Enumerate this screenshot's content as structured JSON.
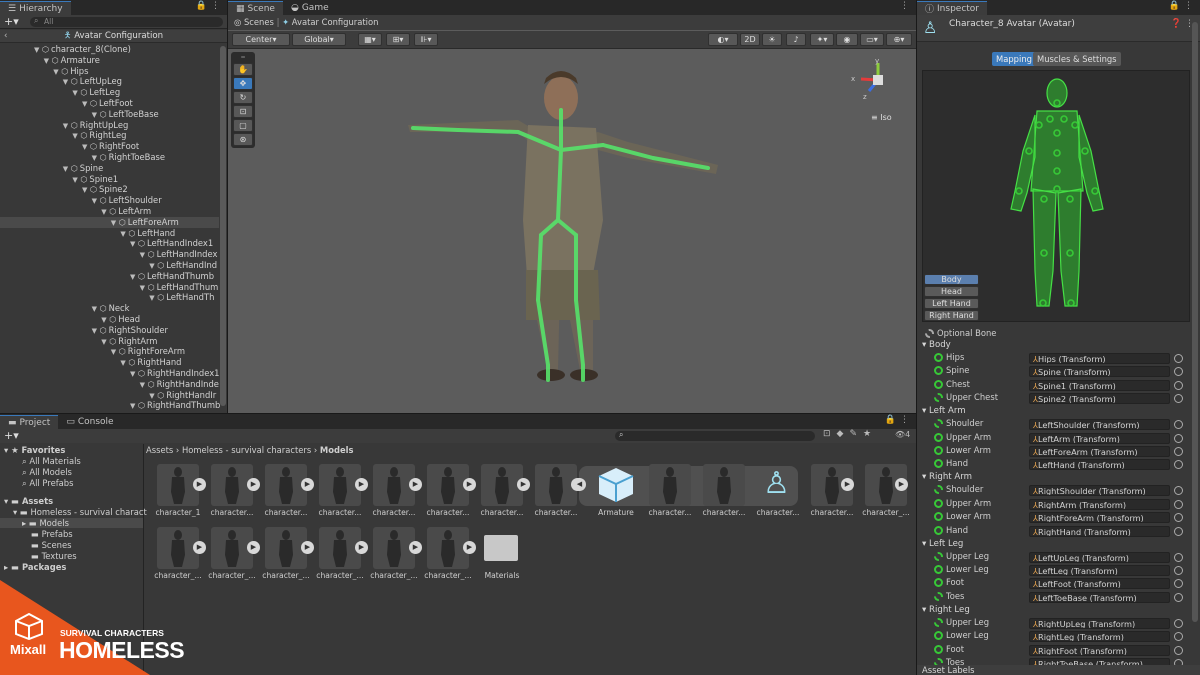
{
  "hierarchy": {
    "tab": "Hierarchy",
    "search_placeholder": "All",
    "header": "Avatar Configuration",
    "rows": [
      {
        "label": "character_8(Clone)",
        "indent": 0
      },
      {
        "label": "Armature",
        "indent": 1
      },
      {
        "label": "Hips",
        "indent": 2
      },
      {
        "label": "LeftUpLeg",
        "indent": 3
      },
      {
        "label": "LeftLeg",
        "indent": 4
      },
      {
        "label": "LeftFoot",
        "indent": 5
      },
      {
        "label": "LeftToeBase",
        "indent": 6
      },
      {
        "label": "RightUpLeg",
        "indent": 3
      },
      {
        "label": "RightLeg",
        "indent": 4
      },
      {
        "label": "RightFoot",
        "indent": 5
      },
      {
        "label": "RightToeBase",
        "indent": 6
      },
      {
        "label": "Spine",
        "indent": 3
      },
      {
        "label": "Spine1",
        "indent": 4
      },
      {
        "label": "Spine2",
        "indent": 5
      },
      {
        "label": "LeftShoulder",
        "indent": 6
      },
      {
        "label": "LeftArm",
        "indent": 7
      },
      {
        "label": "LeftForeArm",
        "indent": 8
      },
      {
        "label": "LeftHand",
        "indent": 9
      },
      {
        "label": "LeftHandIndex1",
        "indent": 10
      },
      {
        "label": "LeftHandIndex",
        "indent": 11
      },
      {
        "label": "LeftHandInd",
        "indent": 12
      },
      {
        "label": "LeftHandThumb",
        "indent": 10
      },
      {
        "label": "LeftHandThum",
        "indent": 11
      },
      {
        "label": "LeftHandTh",
        "indent": 12
      },
      {
        "label": "Neck",
        "indent": 6
      },
      {
        "label": "Head",
        "indent": 7
      },
      {
        "label": "RightShoulder",
        "indent": 6
      },
      {
        "label": "RightArm",
        "indent": 7
      },
      {
        "label": "RightForeArm",
        "indent": 8
      },
      {
        "label": "RightHand",
        "indent": 9
      },
      {
        "label": "RightHandIndex1",
        "indent": 10
      },
      {
        "label": "RightHandInde",
        "indent": 11
      },
      {
        "label": "RightHandIr",
        "indent": 12
      },
      {
        "label": "RightHandThumb",
        "indent": 10
      }
    ]
  },
  "scene": {
    "tabs": [
      "Scene",
      "Game"
    ],
    "breadcrumb_root": "Scenes",
    "breadcrumb_current": "Avatar Configuration",
    "pivot": "Center",
    "space": "Global",
    "mode_2d": "2D",
    "gizmo_label": "Iso",
    "axis_x": "x",
    "axis_y": "y",
    "axis_z": "z"
  },
  "project": {
    "tabs": [
      "Project",
      "Console"
    ],
    "favorites": "Favorites",
    "fav_items": [
      "All Materials",
      "All Models",
      "All Prefabs"
    ],
    "assets": "Assets",
    "asset_folder": "Homeless - survival charact",
    "subfolders": [
      "Models",
      "Prefabs",
      "Scenes",
      "Textures"
    ],
    "packages": "Packages",
    "breadcrumb": [
      "Assets",
      "Homeless - survival characters",
      "Models"
    ],
    "hidden_count": "4",
    "row1": [
      "character_1",
      "character...",
      "character...",
      "character...",
      "character...",
      "character...",
      "character...",
      "character...",
      "Armature",
      "character...",
      "character...",
      "character...",
      "character...",
      "character_..."
    ],
    "row2": [
      "character_...",
      "character_...",
      "character_...",
      "character_...",
      "character_...",
      "character_...",
      "Materials"
    ]
  },
  "inspector": {
    "tab": "Inspector",
    "title": "Character_8 Avatar (Avatar)",
    "tabs": [
      "Mapping",
      "Muscles & Settings"
    ],
    "body_buttons": [
      "Body",
      "Head",
      "Left Hand",
      "Right Hand"
    ],
    "optional_bone": "Optional Bone",
    "sections": [
      {
        "name": "Body",
        "bones": [
          [
            "Hips",
            "Hips (Transform)"
          ],
          [
            "Spine",
            "Spine (Transform)"
          ],
          [
            "Chest",
            "Spine1 (Transform)"
          ],
          [
            "Upper Chest",
            "Spine2 (Transform)"
          ]
        ]
      },
      {
        "name": "Left Arm",
        "bones": [
          [
            "Shoulder",
            "LeftShoulder (Transform)"
          ],
          [
            "Upper Arm",
            "LeftArm (Transform)"
          ],
          [
            "Lower Arm",
            "LeftForeArm (Transform)"
          ],
          [
            "Hand",
            "LeftHand (Transform)"
          ]
        ]
      },
      {
        "name": "Right Arm",
        "bones": [
          [
            "Shoulder",
            "RightShoulder (Transform)"
          ],
          [
            "Upper Arm",
            "RightArm (Transform)"
          ],
          [
            "Lower Arm",
            "RightForeArm (Transform)"
          ],
          [
            "Hand",
            "RightHand (Transform)"
          ]
        ]
      },
      {
        "name": "Left Leg",
        "bones": [
          [
            "Upper Leg",
            "LeftUpLeg (Transform)"
          ],
          [
            "Lower Leg",
            "LeftLeg (Transform)"
          ],
          [
            "Foot",
            "LeftFoot (Transform)"
          ],
          [
            "Toes",
            "LeftToeBase (Transform)"
          ]
        ]
      },
      {
        "name": "Right Leg",
        "bones": [
          [
            "Upper Leg",
            "RightUpLeg (Transform)"
          ],
          [
            "Lower Leg",
            "RightLeg (Transform)"
          ],
          [
            "Foot",
            "RightFoot (Transform)"
          ],
          [
            "Toes",
            "RightToeBase (Transform)"
          ]
        ]
      }
    ],
    "asset_labels": "Asset Labels"
  },
  "branding": {
    "logo": "Mixall",
    "subtitle": "SURVIVAL CHARACTERS",
    "title": "HOMELESS"
  },
  "colors": {
    "accent": "#3a79bb",
    "bone_green": "#37c837",
    "orange": "#e8561e"
  }
}
